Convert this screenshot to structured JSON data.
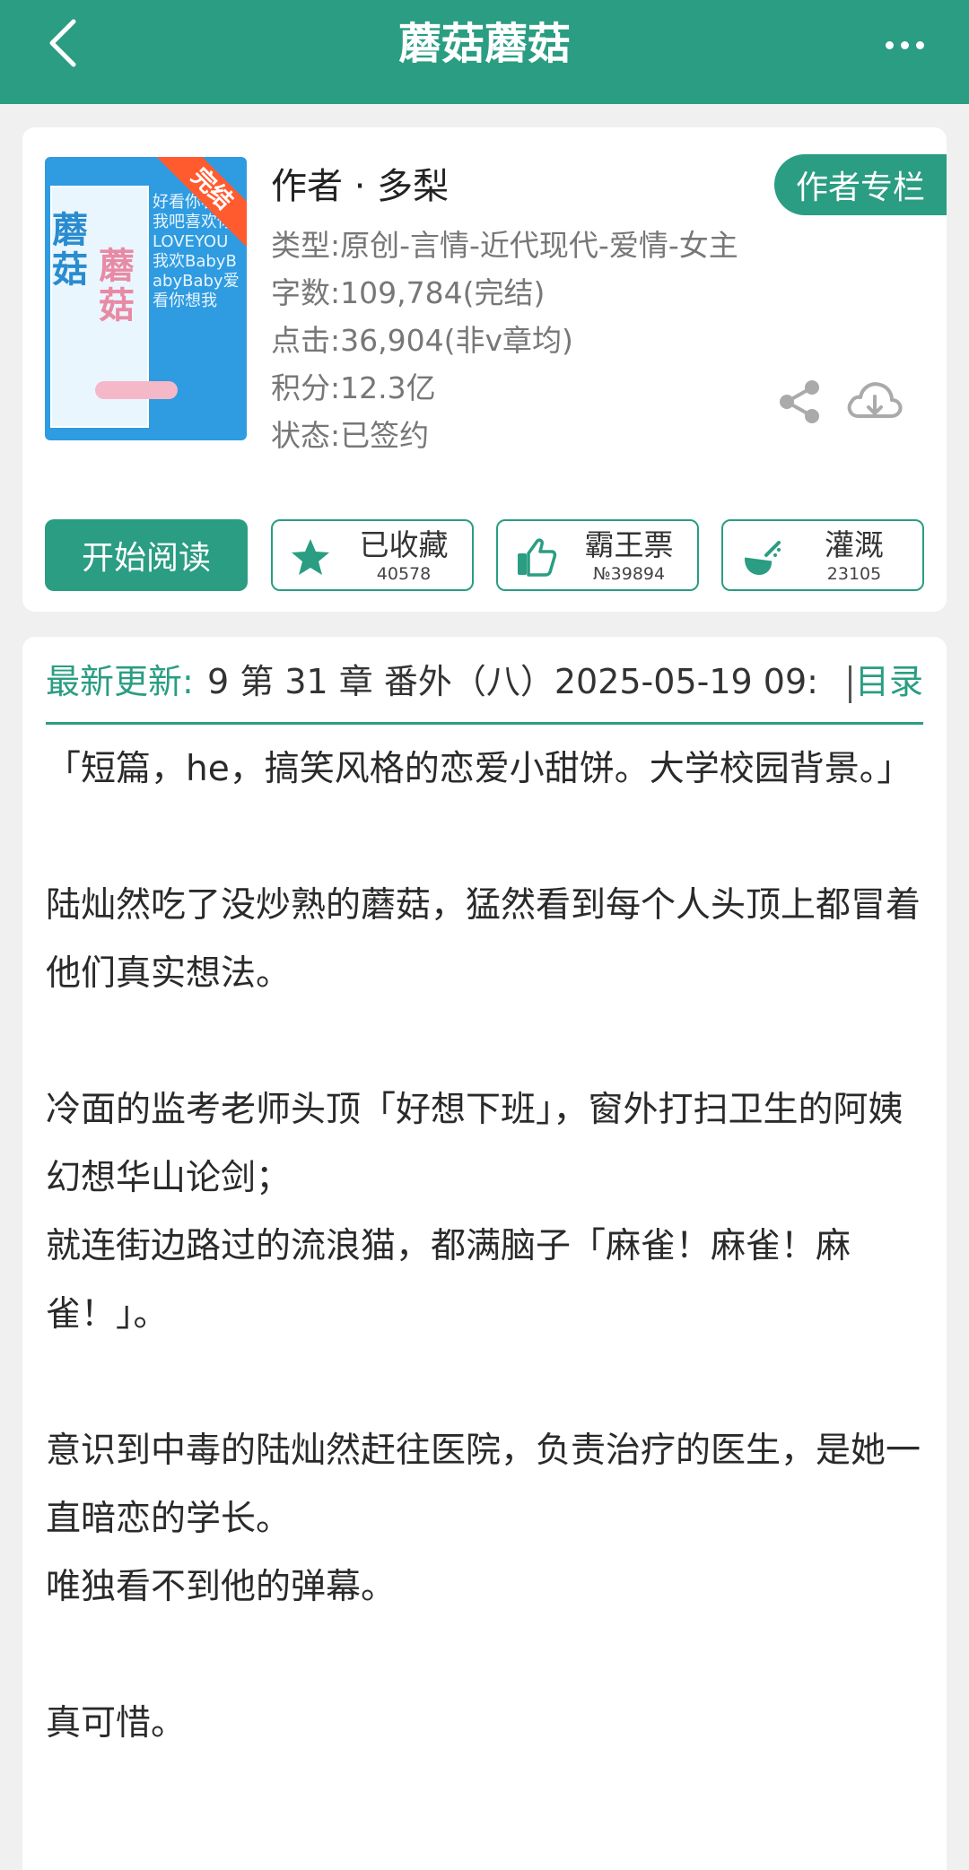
{
  "header": {
    "title": "蘑菇蘑菇"
  },
  "cover": {
    "ribbon": "完结",
    "title_left": "蘑菇",
    "title_right": "蘑菇",
    "bg_text": "好看你看向我吧喜欢你LOVEYOU我欢BabyBabyBaby爱看你想我"
  },
  "book": {
    "author": "作者 · 多梨",
    "author_column": "作者专栏",
    "type": "类型:原创-言情-近代现代-爱情-女主",
    "word_count": "字数:109,784(完结)",
    "clicks": "点击:36,904(非v章均)",
    "points": "积分:12.3亿",
    "status": "状态:已签约"
  },
  "actions": {
    "start_reading": "开始阅读",
    "favorite_label": "已收藏",
    "favorite_count": "40578",
    "vote_label": "霸王票",
    "vote_count": "№39894",
    "water_label": "灌溉",
    "water_count": "23105"
  },
  "update": {
    "label": "最新更新:",
    "text": "9   第 31 章 番外（八）2025-05-19 09:",
    "toc": "目录"
  },
  "intro": "「短篇，he，搞笑风格的恋爱小甜饼。大学校园背景。」\n\n陆灿然吃了没炒熟的蘑菇，猛然看到每个人头顶上都冒着他们真实想法。\n\n冷面的监考老师头顶「好想下班」，窗外打扫卫生的阿姨幻想华山论剑；\n就连街边路过的流浪猫，都满脑子「麻雀！麻雀！麻雀！」。\n\n意识到中毒的陆灿然赶往医院，负责治疗的医生，是她一直暗恋的学长。\n唯独看不到他的弹幕。\n\n真可惜。",
  "colors": {
    "accent": "#2a9d82",
    "ribbon": "#ff5b2e",
    "cover": "#2f9be0"
  },
  "icons": {
    "back": "back-arrow-icon",
    "more": "more-dots-icon",
    "share": "share-icon",
    "download": "cloud-download-icon",
    "favorite": "star-icon",
    "vote": "thumbs-up-icon",
    "water": "watering-icon"
  }
}
